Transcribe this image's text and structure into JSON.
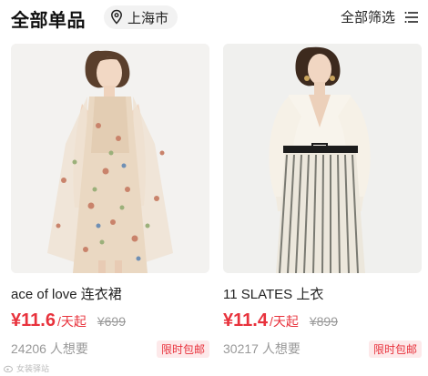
{
  "header": {
    "title": "全部单品",
    "city": "上海市",
    "filter_label": "全部筛选",
    "city_icon": "location-pin-icon",
    "filter_icon": "filter-lines-icon"
  },
  "products": [
    {
      "name": "ace of love 连衣裙",
      "price": "¥11.6",
      "price_suffix": "/天起",
      "original_price": "¥699",
      "want_count": "24206 人想要",
      "badge": "限时包邮"
    },
    {
      "name": "11 SLATES 上衣",
      "price": "¥11.4",
      "price_suffix": "/天起",
      "original_price": "¥899",
      "want_count": "30217 人想要",
      "badge": "限时包邮"
    }
  ],
  "watermark": "女装驿站",
  "colors": {
    "accent": "#e8323c",
    "badge_bg": "#fde9ea",
    "muted": "#999999"
  }
}
